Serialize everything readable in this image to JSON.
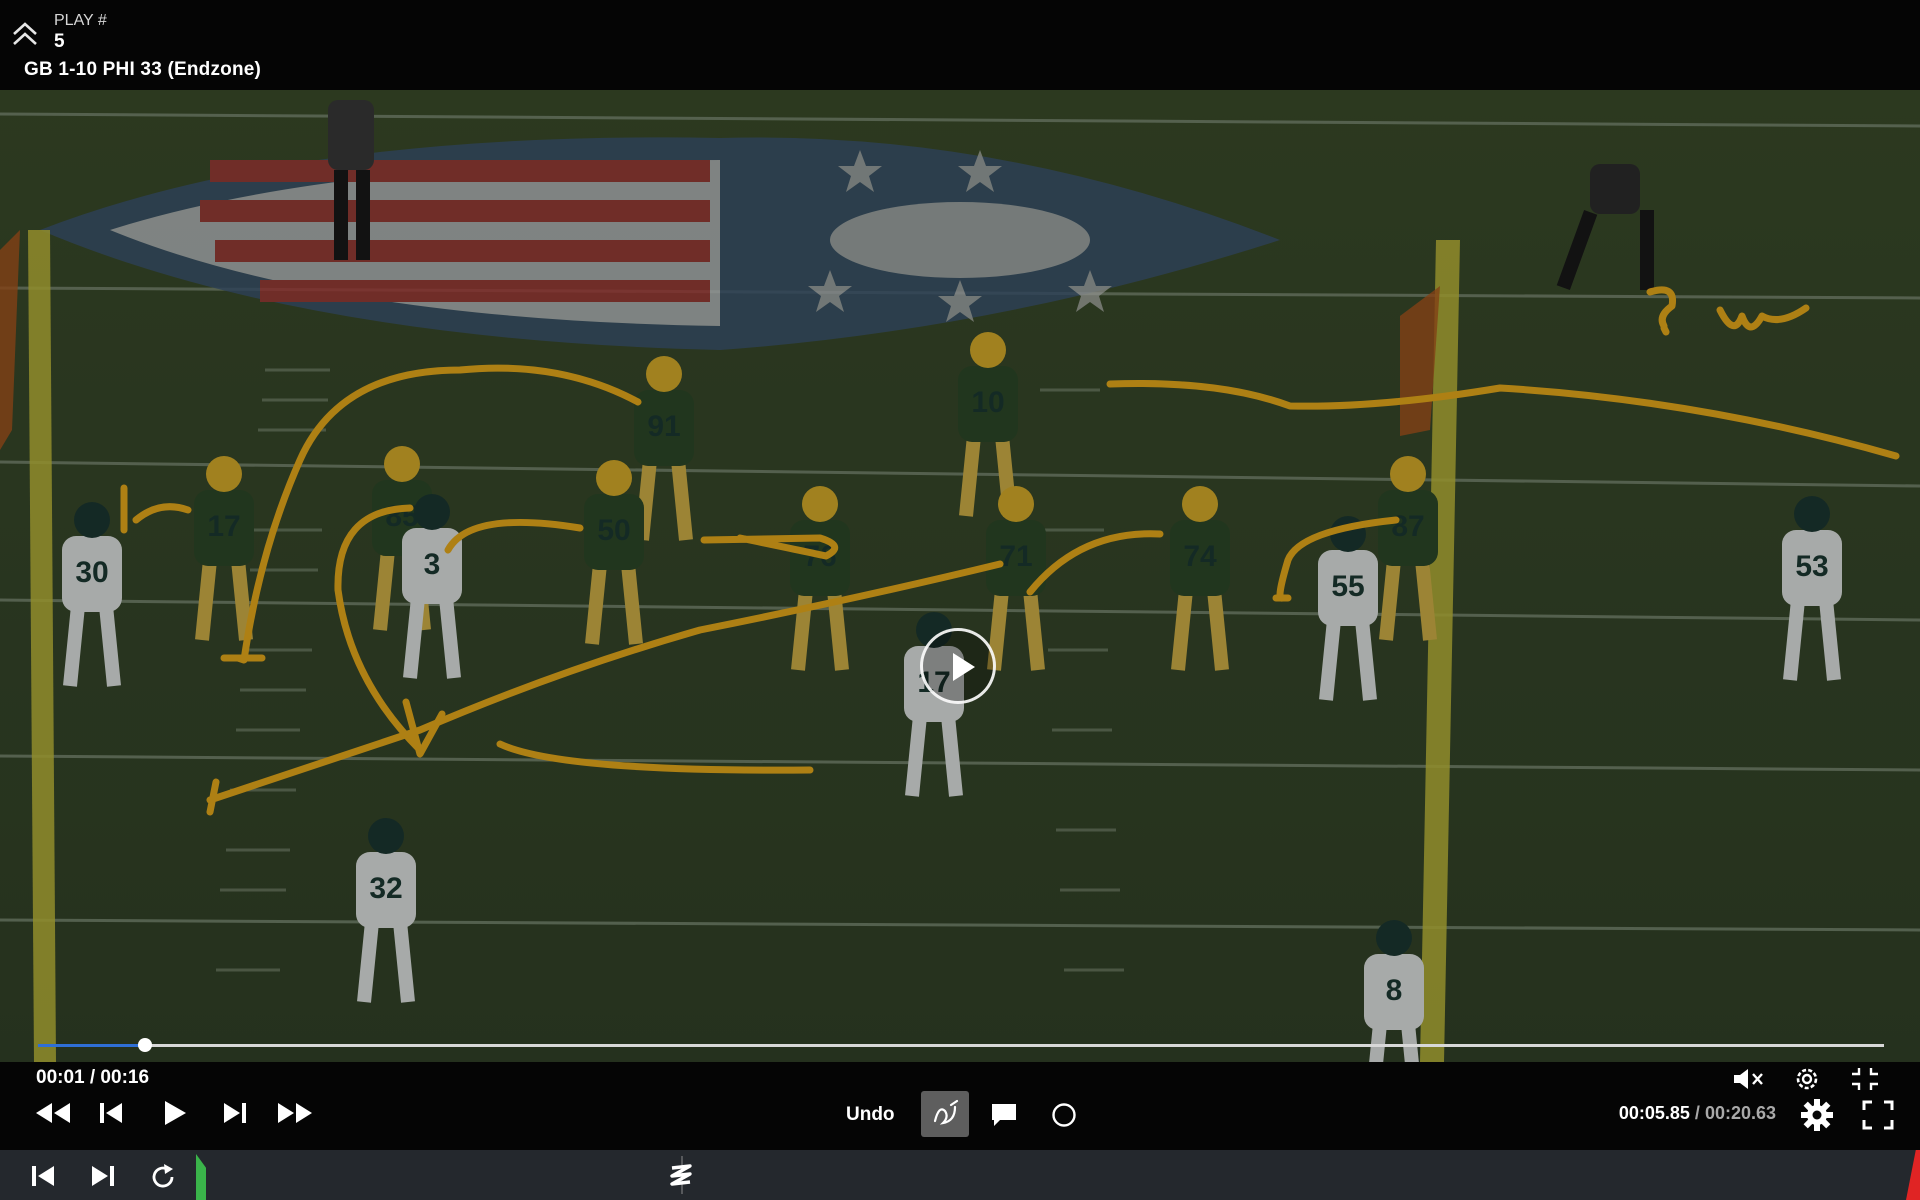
{
  "header": {
    "play_label": "PLAY #",
    "play_number": "5",
    "situation": "GB  1-10  PHI 33 (Endzone)",
    "collapse_icon": "chevrons-up-icon"
  },
  "video": {
    "drawing_color": "#f2b21c",
    "annotation_text": "? W~",
    "jerseys": {
      "green_bay": [
        "17",
        "85",
        "91",
        "50",
        "76",
        "10",
        "71",
        "74",
        "87"
      ],
      "philadelphia": [
        "30",
        "3",
        "17",
        "55",
        "53",
        "32",
        "8"
      ]
    }
  },
  "progress": {
    "fraction": 0.058
  },
  "controls": {
    "elapsed": "00:01 / 00:16",
    "undo_label": "Undo",
    "clip_time_current": "00:05.85",
    "clip_time_separator": " / ",
    "clip_time_total": "00:20.63",
    "icons": [
      "rewind-icon",
      "step-back-icon",
      "play-icon",
      "step-forward-icon",
      "fast-forward-icon",
      "pen-draw-icon",
      "comment-icon",
      "circle-tool-icon",
      "mute-icon",
      "settings-icon",
      "exit-fullscreen-icon",
      "gear-icon",
      "fullscreen-icon"
    ]
  },
  "bottom_bar": {
    "icons": [
      "skip-to-start-icon",
      "skip-to-end-icon",
      "replay-icon",
      "telestrator-icon"
    ]
  }
}
